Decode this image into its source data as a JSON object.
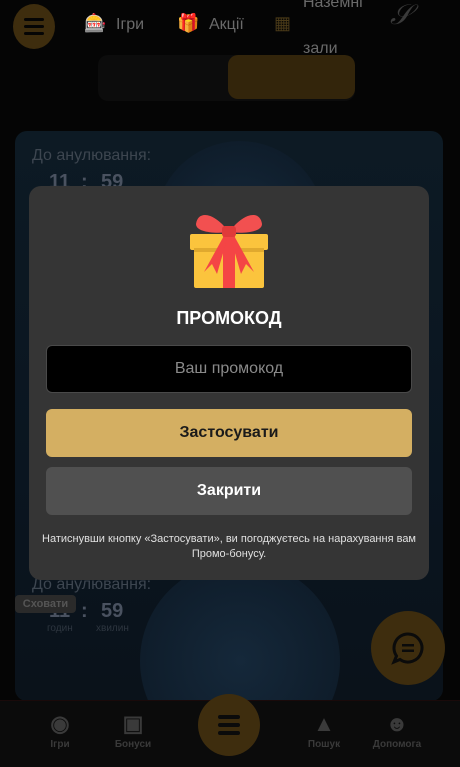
{
  "header": {
    "nav": [
      {
        "label": "Ігри",
        "icon": "slot-machine-icon"
      },
      {
        "label": "Акції",
        "icon": "gift-icon"
      },
      {
        "label_line1": "Наземні",
        "label_line2": "зали",
        "icon": "building-icon"
      }
    ],
    "logo": "Slots"
  },
  "promo_card": {
    "countdown_label": "До анулювання:",
    "timer": {
      "hours": "11",
      "minutes": "59",
      "separator": ":"
    }
  },
  "second_card": {
    "countdown_label": "До анулювання:",
    "hide_label": "Сховати",
    "timer": {
      "hours": "11",
      "minutes": "59",
      "separator": ":",
      "hours_unit": "годин",
      "minutes_unit": "хвилин"
    }
  },
  "bottom_nav": [
    {
      "label": "Ігри",
      "icon": "ornament-icon"
    },
    {
      "label": "Бонуси",
      "icon": "gift-icon"
    },
    {
      "label": "Пошук",
      "icon": "tree-icon"
    },
    {
      "label": "Допомога",
      "icon": "santa-icon"
    }
  ],
  "modal": {
    "title": "ПРОМОКОД",
    "input_placeholder": "Ваш промокод",
    "input_value": "",
    "apply_label": "Застосувати",
    "close_label": "Закрити",
    "note": "Натиснувши кнопку «Застосувати», ви погоджуєтесь на нарахування вам Промо-бонусу."
  },
  "colors": {
    "accent": "#d4af62",
    "modal_bg": "#353535",
    "close_bg": "#505050"
  }
}
